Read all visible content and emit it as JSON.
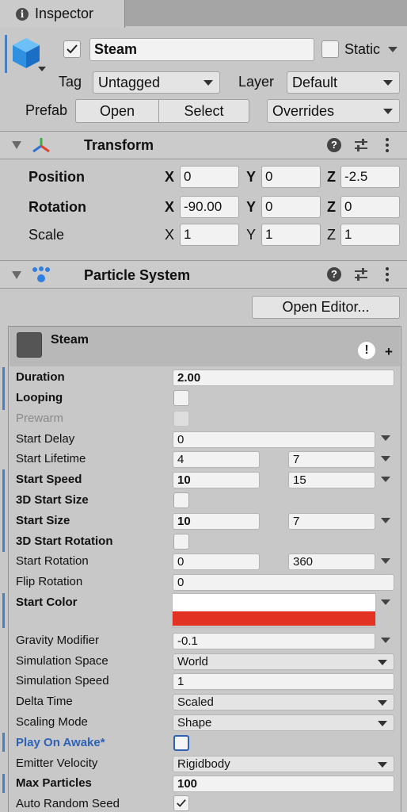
{
  "window": {
    "tab_title": "Inspector",
    "tab_icon": "info-icon"
  },
  "gameobject": {
    "active": true,
    "name": "Steam",
    "static_label": "Static",
    "static_checked": false,
    "tag_label": "Tag",
    "tag_value": "Untagged",
    "layer_label": "Layer",
    "layer_value": "Default",
    "prefab_label": "Prefab",
    "open_label": "Open",
    "select_label": "Select",
    "overrides_label": "Overrides"
  },
  "transform": {
    "title": "Transform",
    "position_label": "Position",
    "rotation_label": "Rotation",
    "scale_label": "Scale",
    "x": "X",
    "y": "Y",
    "z": "Z",
    "position": {
      "x": "0",
      "y": "0",
      "z": "-2.5"
    },
    "rotation": {
      "x": "-90.00",
      "y": "0",
      "z": "0"
    },
    "scale": {
      "x": "1",
      "y": "1",
      "z": "1"
    }
  },
  "particle_system": {
    "title": "Particle System",
    "open_editor_label": "Open Editor...",
    "module_name": "Steam",
    "module_plus": "+",
    "module_warning": "!",
    "rows": {
      "duration": {
        "label": "Duration",
        "value": "2.00"
      },
      "looping": {
        "label": "Looping"
      },
      "prewarm": {
        "label": "Prewarm"
      },
      "start_delay": {
        "label": "Start Delay",
        "value": "0"
      },
      "start_lifetime": {
        "label": "Start Lifetime",
        "min": "4",
        "max": "7"
      },
      "start_speed": {
        "label": "Start Speed",
        "min": "10",
        "max": "15"
      },
      "start_size_3d": {
        "label": "3D Start Size"
      },
      "start_size": {
        "label": "Start Size",
        "min": "10",
        "max": "7"
      },
      "start_rotation_3d": {
        "label": "3D Start Rotation"
      },
      "start_rotation": {
        "label": "Start Rotation",
        "min": "0",
        "max": "360"
      },
      "flip_rotation": {
        "label": "Flip Rotation",
        "value": "0"
      },
      "start_color": {
        "label": "Start Color",
        "color_top": "#ffffff",
        "color_bottom": "#e13223"
      },
      "gravity_modifier": {
        "label": "Gravity Modifier",
        "value": "-0.1"
      },
      "simulation_space": {
        "label": "Simulation Space",
        "value": "World"
      },
      "simulation_speed": {
        "label": "Simulation Speed",
        "value": "1"
      },
      "delta_time": {
        "label": "Delta Time",
        "value": "Scaled"
      },
      "scaling_mode": {
        "label": "Scaling Mode",
        "value": "Shape"
      },
      "play_on_awake": {
        "label": "Play On Awake*"
      },
      "emitter_velocity": {
        "label": "Emitter Velocity",
        "value": "Rigidbody"
      },
      "max_particles": {
        "label": "Max Particles",
        "value": "100"
      },
      "auto_random_seed": {
        "label": "Auto Random Seed",
        "checked": true
      }
    }
  },
  "colors": {
    "accent_blue": "#2d62b8",
    "modified_bar": "#4a7fc1"
  }
}
